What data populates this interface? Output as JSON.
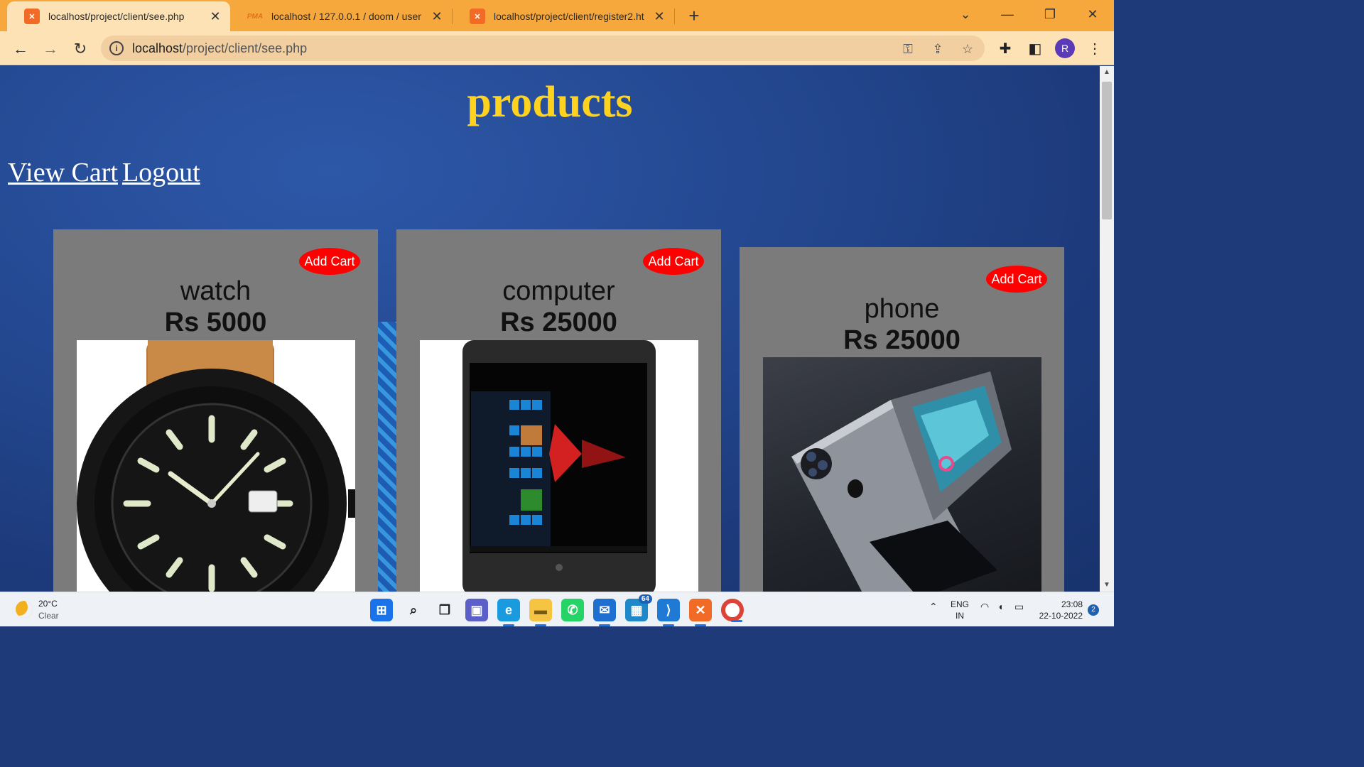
{
  "browser": {
    "tabs": [
      {
        "title": "localhost/project/client/see.php",
        "favicon": "xampp-icon"
      },
      {
        "title": "localhost / 127.0.0.1 / doom / user |",
        "favicon": "phpmyadmin-icon"
      },
      {
        "title": "localhost/project/client/register2.ht",
        "favicon": "xampp-icon"
      }
    ],
    "url_host": "localhost",
    "url_path": "/project/client/see.php",
    "profile_initial": "R"
  },
  "page": {
    "title": "products",
    "links": {
      "view_cart": "View Cart",
      "logout": "Logout"
    },
    "products": [
      {
        "name": "watch",
        "price": "Rs 5000",
        "button": "Add Cart"
      },
      {
        "name": "computer",
        "price": "Rs 25000",
        "button": "Add Cart"
      },
      {
        "name": "phone",
        "price": "Rs 25000",
        "button": "Add Cart"
      }
    ]
  },
  "taskbar": {
    "weather_temp": "20°C",
    "weather_cond": "Clear",
    "mail_badge": "64",
    "lang_line1": "ENG",
    "lang_line2": "IN",
    "time": "23:08",
    "date": "22-10-2022",
    "notifications": "2"
  },
  "colors": {
    "title": "#ffd21f",
    "add_cart": "#ff0000",
    "card": "#7b7b7b",
    "tabbar": "#f7a83c"
  }
}
